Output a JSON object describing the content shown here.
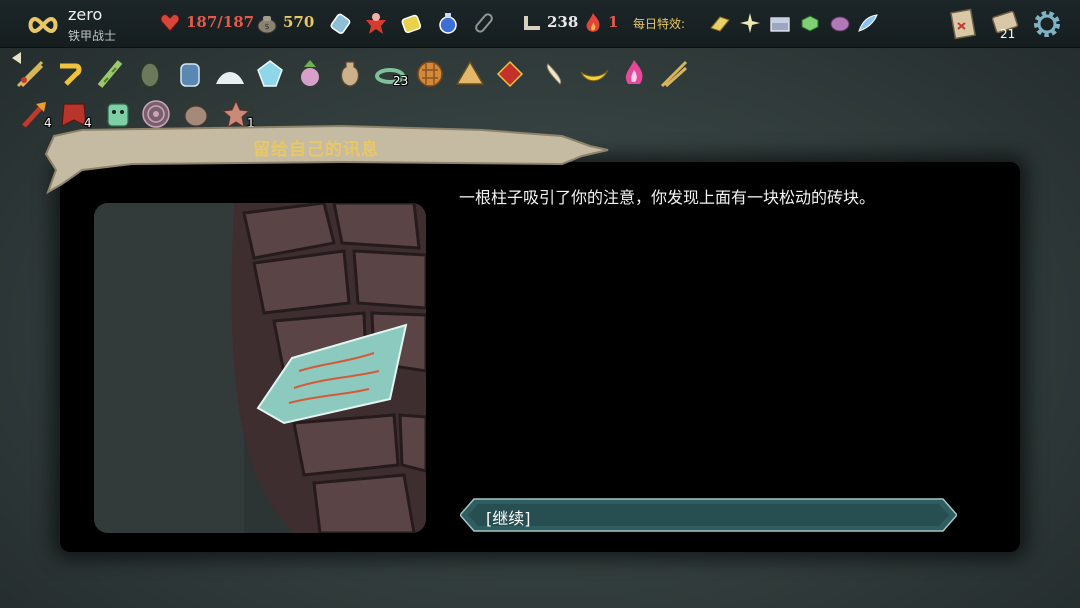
{
  "player": {
    "name": "zero",
    "class": "铁甲战士",
    "portrait_icon": "infinity-icon"
  },
  "stats": {
    "hp": "187/187",
    "gold": "570",
    "floor": "238",
    "ascension": "1"
  },
  "potions": [
    "potion-bottle-icon",
    "potion-flask-red-icon",
    "potion-jar-yellow-icon",
    "potion-round-blue-icon",
    "empty-potion-slot-icon"
  ],
  "daily": {
    "label": "每日特效:",
    "modifiers": [
      "gold-bar-icon",
      "sparkle-icon",
      "chest-icon",
      "green-cube-icon",
      "purple-shell-icon",
      "blue-feather-icon"
    ]
  },
  "top_right": {
    "deck_count": "21"
  },
  "relics_row1": [
    {
      "icon": "burning-blood-icon",
      "count": ""
    },
    {
      "icon": "gold-hook-icon",
      "count": ""
    },
    {
      "icon": "bamboo-icon",
      "count": ""
    },
    {
      "icon": "egg-icon",
      "count": ""
    },
    {
      "icon": "jar-icon",
      "count": ""
    },
    {
      "icon": "salt-pile-icon",
      "count": ""
    },
    {
      "icon": "crystal-icon",
      "count": ""
    },
    {
      "icon": "turnip-icon",
      "count": ""
    },
    {
      "icon": "vase-icon",
      "count": ""
    },
    {
      "icon": "snake-ring-icon",
      "count": "23"
    },
    {
      "icon": "waffle-icon",
      "count": ""
    },
    {
      "icon": "pyramid-icon",
      "count": ""
    },
    {
      "icon": "red-cushion-icon",
      "count": ""
    },
    {
      "icon": "bone-icon",
      "count": ""
    },
    {
      "icon": "banana-icon",
      "count": ""
    },
    {
      "icon": "magic-flame-icon",
      "count": ""
    },
    {
      "icon": "crossed-sticks-icon",
      "count": ""
    }
  ],
  "relics_row2": [
    {
      "icon": "fire-axe-icon",
      "count": "4"
    },
    {
      "icon": "red-cape-icon",
      "count": "4"
    },
    {
      "icon": "green-mask-icon",
      "count": ""
    },
    {
      "icon": "maze-disc-icon",
      "count": ""
    },
    {
      "icon": "stone-pot-icon",
      "count": ""
    },
    {
      "icon": "star-figure-icon",
      "count": "1"
    }
  ],
  "event": {
    "title": "留给自己的讯息",
    "body": "一根柱子吸引了你的注意，你发现上面有一块松动的砖块。",
    "option": "[继续]"
  },
  "colors": {
    "accent_gold": "#e8c766",
    "hp_red": "#e35a4c",
    "button_teal": "#2f5d60",
    "panel": "#000000"
  }
}
